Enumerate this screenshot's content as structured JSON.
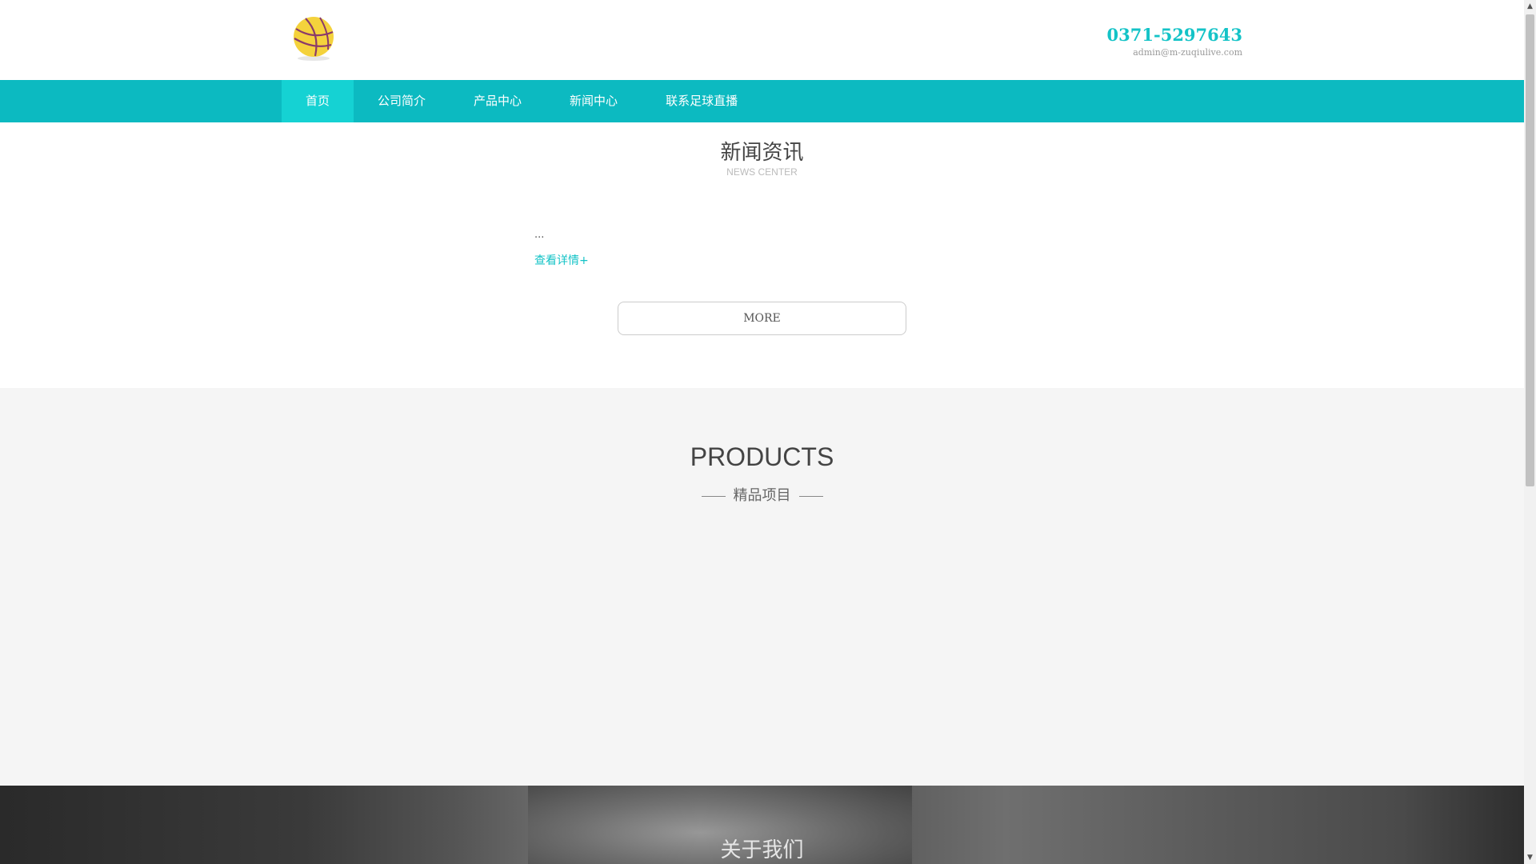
{
  "header": {
    "phone": "0371-5297643",
    "email": "admin@m-zuqiulive.com"
  },
  "nav": {
    "items": [
      {
        "label": "首页"
      },
      {
        "label": "公司简介"
      },
      {
        "label": "产品中心"
      },
      {
        "label": "新闻中心"
      },
      {
        "label": "联系足球直播"
      }
    ]
  },
  "news": {
    "title": "新闻资讯",
    "subtitle": "NEWS CENTER",
    "ellipsis": "...",
    "detail_link": "查看详情+",
    "more_button": "MORE"
  },
  "products": {
    "title": "PRODUCTS",
    "subtitle": "精品项目"
  },
  "about": {
    "title": "关于我们"
  },
  "colors": {
    "accent": "#14c3c7",
    "nav_bg": "#0cbac1",
    "nav_active": "#15d2d3",
    "products_bg": "#f5f5f5"
  },
  "icons": {
    "logo": "basketball-logo",
    "scroll_up": "arrow-up-icon",
    "scroll_down": "arrow-down-icon"
  }
}
